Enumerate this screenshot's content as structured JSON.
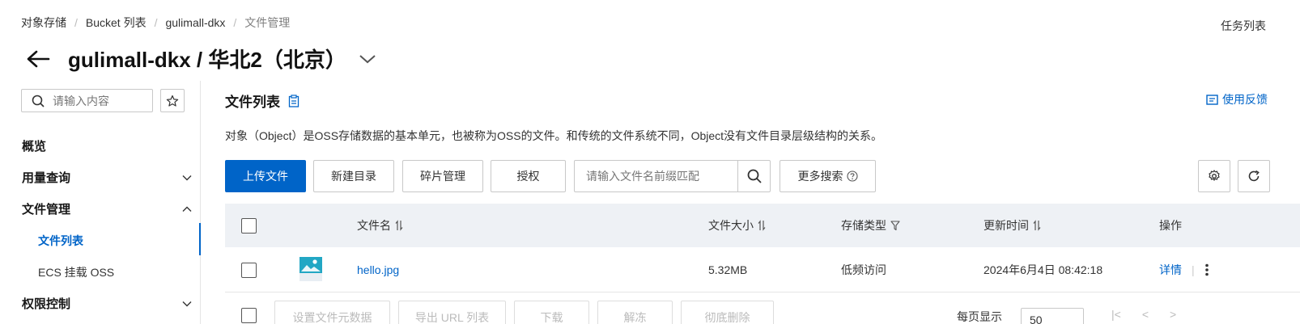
{
  "breadcrumb": [
    "对象存储",
    "Bucket 列表",
    "gulimall-dkx",
    "文件管理"
  ],
  "header": {
    "task_list": "任务列表",
    "title": "gulimall-dkx / 华北2（北京）"
  },
  "sidebar": {
    "search_placeholder": "请输入内容",
    "items": [
      {
        "label": "概览"
      },
      {
        "label": "用量查询"
      },
      {
        "label": "文件管理"
      },
      {
        "label": "文件列表"
      },
      {
        "label": "ECS 挂载 OSS"
      },
      {
        "label": "权限控制"
      }
    ]
  },
  "main": {
    "section_title": "文件列表",
    "feedback": "使用反馈",
    "description": "对象（Object）是OSS存储数据的基本单元，也被称为OSS的文件。和传统的文件系统不同，Object没有文件目录层级结构的关系。",
    "toolbar": {
      "upload": "上传文件",
      "new_dir": "新建目录",
      "fragments": "碎片管理",
      "authorize": "授权",
      "search_placeholder": "请输入文件名前缀匹配",
      "more_search": "更多搜索"
    },
    "table": {
      "columns": [
        "文件名",
        "文件大小",
        "存储类型",
        "更新时间",
        "操作"
      ],
      "rows": [
        {
          "name": "hello.jpg",
          "size": "5.32MB",
          "storage": "低频访问",
          "updated": "2024年6月4日 08:42:18",
          "action": "详情"
        }
      ]
    },
    "bottom": {
      "buttons": [
        "设置文件元数据",
        "导出 URL 列表",
        "下载",
        "解冻",
        "彻底删除"
      ],
      "pager_label": "每页显示",
      "pager_value": "50"
    }
  },
  "colors": {
    "accent": "#0064c8",
    "header_bg": "#eef1f5"
  }
}
